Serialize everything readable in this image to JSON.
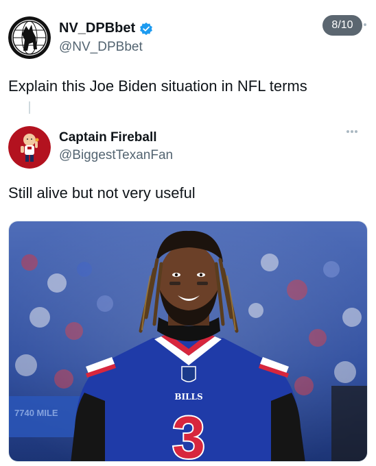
{
  "quoted_author": {
    "display_name": "NV_DPBbet",
    "handle": "@NV_DPBbet",
    "verified_icon": "verified-badge-icon",
    "avatar_icon": "goat-logo-icon"
  },
  "counter": "8/10",
  "main_text": "Explain this Joe Biden situation in NFL terms",
  "reply": {
    "display_name": "Captain Fireball",
    "handle": "@BiggestTexanFan",
    "text": "Still alive but not very useful",
    "more_icon": "more-options-icon"
  },
  "media": {
    "jersey_team": "BILLS",
    "jersey_number": "3",
    "stadium_banner": "7740 MILE"
  },
  "colors": {
    "accent": "#1d9bf0",
    "jersey_blue": "#1f3ba8",
    "jersey_red": "#d7263d"
  }
}
